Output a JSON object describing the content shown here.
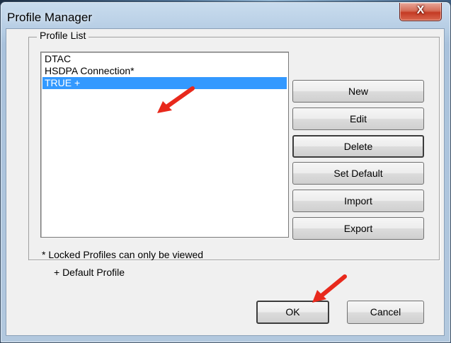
{
  "window": {
    "title": "Profile Manager",
    "close_glyph": "X"
  },
  "group": {
    "label": "Profile List"
  },
  "profiles": [
    {
      "label": "DTAC",
      "selected": false
    },
    {
      "label": "HSDPA Connection*",
      "selected": false
    },
    {
      "label": "TRUE +",
      "selected": true
    }
  ],
  "buttons": {
    "new": "New",
    "edit": "Edit",
    "delete": "Delete",
    "set_default": "Set Default",
    "import": "Import",
    "export": "Export"
  },
  "notes": {
    "locked": "* Locked Profiles can only be viewed",
    "default": "+ Default Profile"
  },
  "footer": {
    "ok": "OK",
    "cancel": "Cancel"
  },
  "colors": {
    "selection": "#3399ff",
    "annotation_arrow": "#e8291c",
    "close_button": "#c43a23"
  },
  "icons": [
    "close-icon",
    "annotation-arrow-icon"
  ]
}
